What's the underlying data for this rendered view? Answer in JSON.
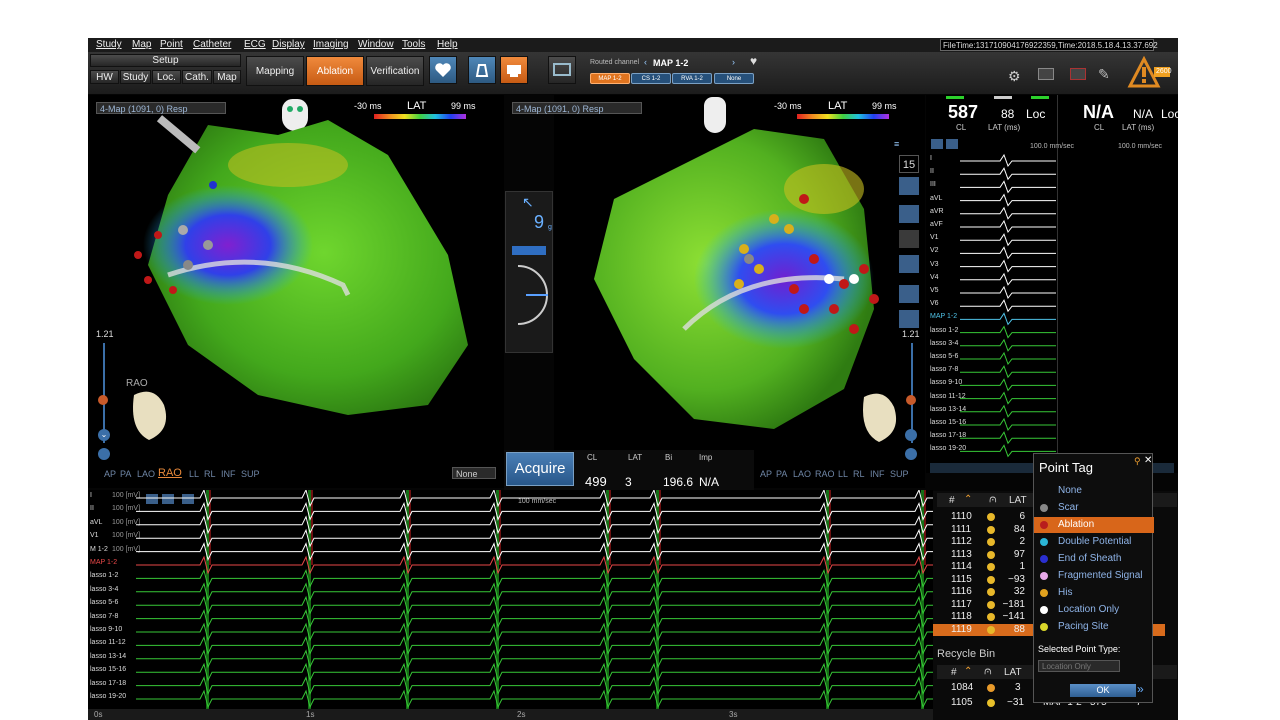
{
  "menu": {
    "items": [
      "Study",
      "Map",
      "Point",
      "Catheter",
      "ECG",
      "Display",
      "Imaging",
      "Window",
      "Tools",
      "Help"
    ],
    "file_info": "FileTime:131710904176922359,Time:2018.5.18.4.13.37.692"
  },
  "toolbar": {
    "setup_label": "Setup",
    "setup_tabs": [
      "HW",
      "Study",
      "Loc.",
      "Cath.",
      "Map"
    ],
    "mapping": "Mapping",
    "ablation": "Ablation",
    "verification": "Verification",
    "routed_channel_label": "Routed channel",
    "routed_channel_value": "MAP 1-2",
    "channel_chips": [
      "MAP 1-2",
      "CS 1-2",
      "RVA 1-2",
      "None"
    ],
    "warning_value": "2600"
  },
  "left_view": {
    "map_select": "4-Map (1091, 0) Resp",
    "lat_label": "LAT",
    "lat_min": "-30 ms",
    "lat_max": "99 ms",
    "scale_value": "1.21",
    "orientation_label": "RAO",
    "views": [
      "AP",
      "PA",
      "LAO",
      "RAO",
      "LL",
      "RL",
      "INF",
      "SUP"
    ],
    "selected_view": "RAO",
    "none_select": "None"
  },
  "right_view": {
    "map_select": "4-Map (1091, 0) Resp",
    "lat_label": "LAT",
    "lat_min": "-30 ms",
    "lat_max": "99 ms",
    "scale_value": "1.21",
    "side_counter": "15",
    "views": [
      "AP",
      "PA",
      "LAO",
      "RAO",
      "LL",
      "RL",
      "INF",
      "SUP"
    ],
    "selected_view": "RAO"
  },
  "force_widget": {
    "value": "9",
    "unit": "g"
  },
  "acquire": {
    "button": "Acquire",
    "headers": [
      "CL",
      "LAT",
      "Bi",
      "Imp"
    ],
    "cl": "499",
    "lat": "3",
    "bi": "196.6",
    "imp": "N/A"
  },
  "ecg_header": {
    "cl_value": "587",
    "cl_label": "CL",
    "lat_value": "88",
    "lat_label": "LAT (ms)",
    "loc_label": "Loc",
    "na_big": "N/A",
    "na_small": "N/A",
    "na_cl": "CL",
    "na_lat": "LAT (ms)",
    "loc2": "Loc",
    "speed1": "100.0 mm/sec",
    "speed2": "100.0 mm/sec"
  },
  "ecg_channels": [
    "I",
    "II",
    "III",
    "aVL",
    "aVR",
    "aVF",
    "V1",
    "V2",
    "V3",
    "V4",
    "V5",
    "V6",
    "MAP 1-2",
    "lasso 1-2",
    "lasso 3-4",
    "lasso 5-6",
    "lasso 7-8",
    "lasso 9-10",
    "lasso 11-12",
    "lasso 13-14",
    "lasso 15-16",
    "lasso 17-18",
    "lasso 19-20"
  ],
  "bottom_strip": {
    "top_labels": [
      "I",
      "II",
      "aVL",
      "V1",
      "M 1-2",
      "MAP 1-2"
    ],
    "unit_labels": [
      "100 [mV]",
      "100 [mV]",
      "100 [mV]",
      "100 [mV]",
      "100 [mV]"
    ],
    "channels": [
      "lasso 1-2",
      "lasso 3-4",
      "lasso 5-6",
      "lasso 7-8",
      "lasso 9-10",
      "lasso 11-12",
      "lasso 13-14",
      "lasso 15-16",
      "lasso 17-18",
      "lasso 19-20"
    ],
    "time_labels": [
      "0s",
      "1s",
      "2s",
      "3s"
    ],
    "speed": "100 mm/sec"
  },
  "points_table": {
    "headers": [
      "#",
      "LAT"
    ],
    "rows": [
      {
        "id": "1110",
        "lat": "6"
      },
      {
        "id": "1111",
        "lat": "84"
      },
      {
        "id": "1112",
        "lat": "2"
      },
      {
        "id": "1113",
        "lat": "97"
      },
      {
        "id": "1114",
        "lat": "1"
      },
      {
        "id": "1115",
        "lat": "−93"
      },
      {
        "id": "1116",
        "lat": "32"
      },
      {
        "id": "1117",
        "lat": "−181"
      },
      {
        "id": "1118",
        "lat": "−141"
      },
      {
        "id": "1119",
        "lat": "88"
      }
    ],
    "selected_id": "1119"
  },
  "recycle_bin": {
    "title": "Recycle Bin",
    "headers": [
      "#",
      "LAT"
    ],
    "rows": [
      {
        "id": "1084",
        "lat": "3",
        "channel": "",
        "cl": "",
        "n": ""
      },
      {
        "id": "1105",
        "lat": "−31",
        "channel": "MAP 1-2",
        "cl": "575",
        "n": "7"
      }
    ]
  },
  "point_tag": {
    "title": "Point Tag",
    "items": [
      {
        "label": "None",
        "color": ""
      },
      {
        "label": "Scar",
        "color": "#888888"
      },
      {
        "label": "Ablation",
        "color": "#b81d1d"
      },
      {
        "label": "Double Potential",
        "color": "#2bb5d6"
      },
      {
        "label": "End of Sheath",
        "color": "#2a2fd0"
      },
      {
        "label": "Fragmented Signal",
        "color": "#e7a8e8"
      },
      {
        "label": "His",
        "color": "#e2a21e"
      },
      {
        "label": "Location Only",
        "color": "#ffffff"
      },
      {
        "label": "Pacing Site",
        "color": "#d9d62a"
      }
    ],
    "selected": "Ablation",
    "selected_type_label": "Selected Point Type:",
    "type_select": "Location Only",
    "ok": "OK"
  }
}
